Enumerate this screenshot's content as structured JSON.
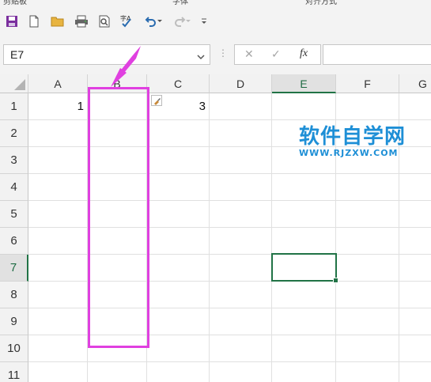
{
  "ribbon_groups": [
    "剪贴板",
    "字体",
    "对齐方式"
  ],
  "quick_access": [
    {
      "name": "save-icon"
    },
    {
      "name": "new-icon"
    },
    {
      "name": "open-icon"
    },
    {
      "name": "print-icon"
    },
    {
      "name": "print-preview-icon"
    },
    {
      "name": "spelling-icon"
    },
    {
      "name": "undo-icon"
    },
    {
      "name": "redo-icon"
    },
    {
      "name": "customize-icon"
    }
  ],
  "formula_bar": {
    "name_box": "E7",
    "cancel": "✕",
    "enter": "✓",
    "fx": "fx",
    "formula": ""
  },
  "columns": [
    "A",
    "B",
    "C",
    "D",
    "E",
    "F",
    "G"
  ],
  "rows": [
    "1",
    "2",
    "3",
    "4",
    "5",
    "6",
    "7",
    "8",
    "9",
    "10",
    "11"
  ],
  "cells": {
    "A1": "1",
    "C1": "3"
  },
  "active_cell": "E7",
  "watermark": {
    "title": "软件自学网",
    "url": "WWW.RJZXW.COM"
  },
  "colors": {
    "accent": "#217346",
    "highlight": "#e040e0",
    "watermark": "#1e8fd6"
  }
}
